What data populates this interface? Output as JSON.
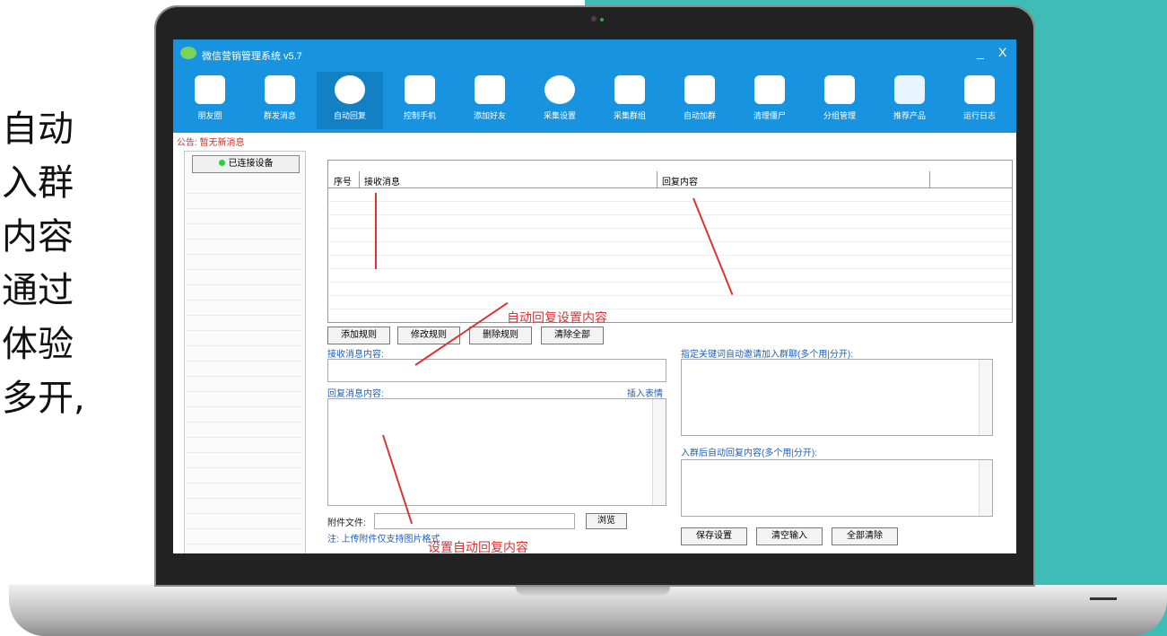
{
  "side_text": [
    "自动",
    "入群",
    "内容",
    "通过",
    "体验",
    "多开,"
  ],
  "app": {
    "title": "微信营销管理系统 v5.7",
    "min_btn": "_",
    "close_btn": "X",
    "notice": "公告: 暂无新消息",
    "toolbar": [
      {
        "label": "朋友圈",
        "icon": "wechat-icon"
      },
      {
        "label": "群发消息",
        "icon": "message-icon"
      },
      {
        "label": "自动回复",
        "icon": "robot-icon"
      },
      {
        "label": "控制手机",
        "icon": "grid-icon"
      },
      {
        "label": "添加好友",
        "icon": "add-user-icon"
      },
      {
        "label": "采集设置",
        "icon": "aperture-icon"
      },
      {
        "label": "采集群组",
        "icon": "qr-icon"
      },
      {
        "label": "自动加群",
        "icon": "add-group-icon"
      },
      {
        "label": "清理僵尸",
        "icon": "users-icon"
      },
      {
        "label": "分组管理",
        "icon": "screen-icon"
      },
      {
        "label": "推荐产品",
        "icon": "recommend-icon"
      },
      {
        "label": "运行日志",
        "icon": "log-icon"
      }
    ],
    "left_button": "已连接设备",
    "table_headers": [
      "序号",
      "接收消息",
      "回复内容"
    ],
    "buttons": {
      "add": "添加规则",
      "modify": "修改规则",
      "delete": "删除规则",
      "clear": "清除全部"
    },
    "labels": {
      "receive": "接收消息内容:",
      "reply": "回复消息内容:",
      "insert_emoji": "插入表情",
      "group_keyword": "指定关键词自动邀请加入群聊(多个用|分开):",
      "group_reply": "入群后自动回复内容(多个用|分开):",
      "attach": "附件文件:",
      "note": "注: 上传附件仅支持图片格式",
      "browse": "浏览"
    },
    "bottom_buttons": [
      "保存设置",
      "清空输入",
      "全部清除"
    ],
    "annotations": {
      "mid": "自动回复设置内容",
      "bottom": "设置自动回复内容"
    }
  },
  "colors": {
    "teal": "#3fbcb6",
    "titlebar": "#1793e0",
    "arrow": "#dd3333"
  }
}
